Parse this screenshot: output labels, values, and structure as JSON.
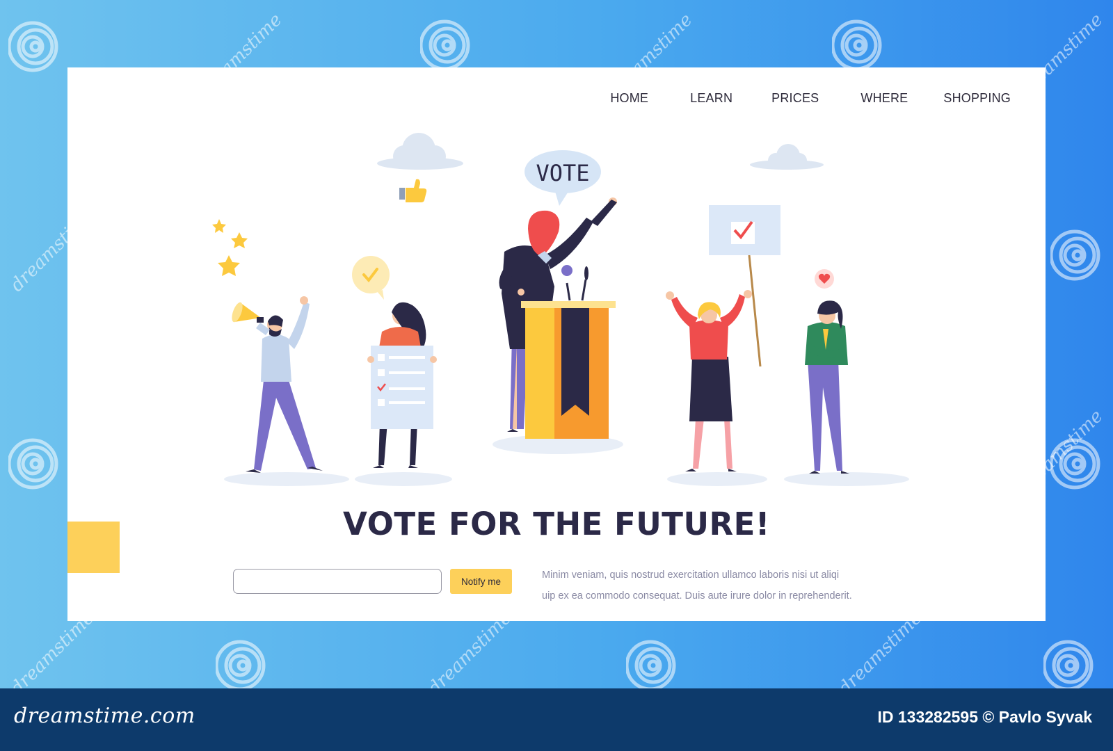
{
  "colors": {
    "background_start": "#6fc3ee",
    "background_end": "#2f86ec",
    "card": "#ffffff",
    "accent_yellow": "#fdd05a",
    "accent_orange": "#f79a2e",
    "navy": "#2b2947",
    "purple": "#7a6fc8",
    "footer": "#0d3a6b"
  },
  "nav": {
    "items": [
      {
        "label": "HOME"
      },
      {
        "label": "LEARN"
      },
      {
        "label": "PRICES"
      },
      {
        "label": "WHERE"
      },
      {
        "label": "SHOPPING"
      }
    ]
  },
  "hero": {
    "speech_bubble": "VOTE",
    "headline": "VOTE FOR THE FUTURE!"
  },
  "form": {
    "email_value": "",
    "notify_label": "Notify me"
  },
  "description": {
    "lines": [
      "Minim veniam, quis nostrud exercitation ullamco laboris nisi ut aliqi",
      "uip ex ea commodo consequat. Duis aute irure dolor in reprehenderit."
    ]
  },
  "watermark": {
    "text": "dreamstime",
    "icon": "spiral-icon"
  },
  "footer": {
    "logo": "dreamstime.com",
    "image_id": "ID 133282595 © Pavlo Syvak"
  }
}
